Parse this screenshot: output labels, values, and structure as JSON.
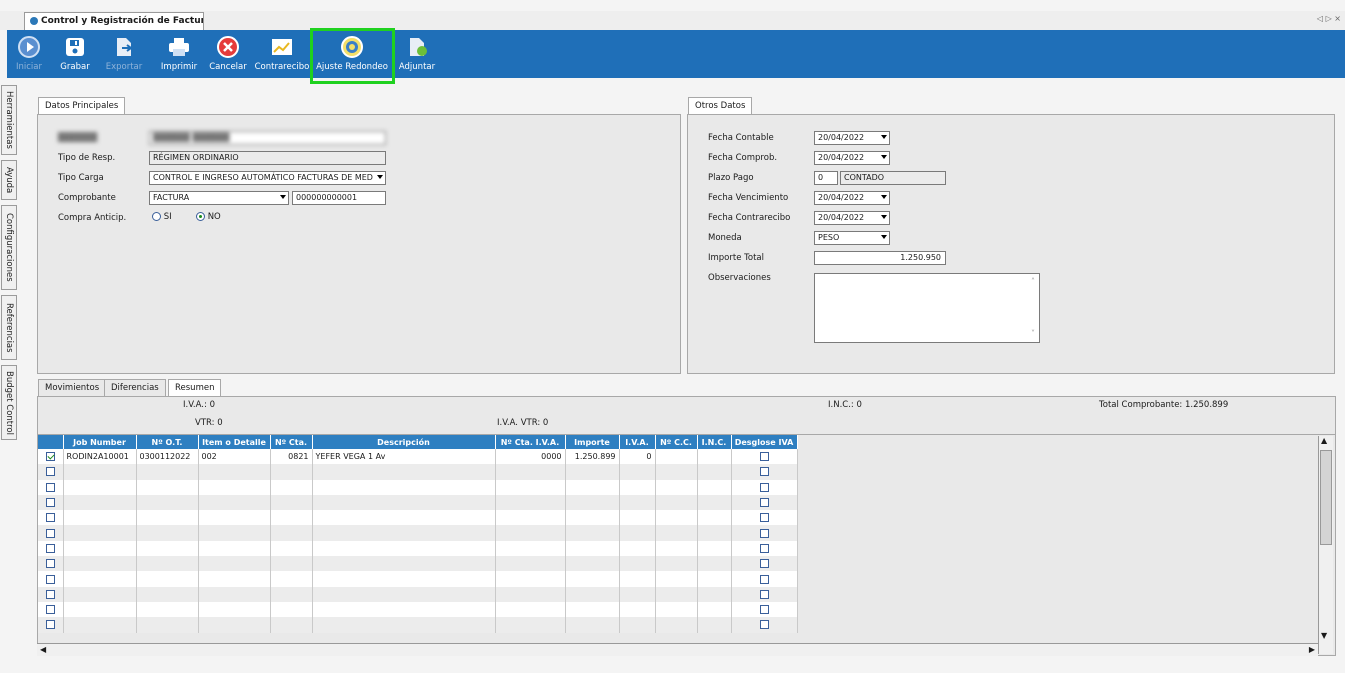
{
  "window": {
    "tab_title": "Control y Registración de Factura..."
  },
  "toolbar": {
    "iniciar": "Iniciar",
    "grabar": "Grabar",
    "exportar": "Exportar",
    "imprimir": "Imprimir",
    "cancelar": "Cancelar",
    "contrarecibo": "Contrarecibo",
    "ajuste": "Ajuste Redondeo",
    "adjuntar": "Adjuntar"
  },
  "side_tabs": [
    "Herramientas",
    "Ayuda",
    "Configuraciones",
    "Referencias",
    "Budget Control"
  ],
  "datos": {
    "tab": "Datos Principales",
    "tipo_resp_label": "Tipo de Resp.",
    "tipo_resp": "RÉGIMEN ORDINARIO",
    "tipo_carga_label": "Tipo Carga",
    "tipo_carga": "CONTROL E INGRESO AUTOMÁTICO FACTURAS DE MED",
    "comprobante_label": "Comprobante",
    "comprobante": "FACTURA",
    "comprobante_num": "000000000001",
    "compra_label": "Compra Anticip.",
    "si": "SI",
    "no": "NO"
  },
  "otros": {
    "tab": "Otros Datos",
    "fecha_contable_label": "Fecha Contable",
    "fecha_contable": "20/04/2022",
    "fecha_comprob_label": "Fecha Comprob.",
    "fecha_comprob": "20/04/2022",
    "plazo_label": "Plazo Pago",
    "plazo_num": "0",
    "plazo_text": "CONTADO",
    "venc_label": "Fecha Vencimiento",
    "venc": "20/04/2022",
    "contra_label": "Fecha Contrarecibo",
    "contra": "20/04/2022",
    "moneda_label": "Moneda",
    "moneda": "PESO",
    "importe_label": "Importe Total",
    "importe": "1.250.950",
    "obs_label": "Observaciones"
  },
  "lower": {
    "tabs": [
      "Movimientos",
      "Diferencias",
      "Resumen"
    ],
    "iva": "I.V.A.: 0",
    "vtr": "VTR: 0",
    "iva_vtr": "I.V.A. VTR: 0",
    "inc": "I.N.C.: 0",
    "total": "Total Comprobante: 1.250.899"
  },
  "grid": {
    "headers": [
      "Job Number",
      "Nº O.T.",
      "Item o Detalle",
      "Nº Cta.",
      "Descripción",
      "Nº Cta. I.V.A.",
      "Importe",
      "I.V.A.",
      "Nº C.C.",
      "I.N.C.",
      "Desglose IVA"
    ],
    "row1": [
      "RODIN2A10001",
      "0300112022",
      "002",
      "0821",
      "YEFER VEGA 1 Av",
      "0000",
      "1.250.899",
      "0",
      "",
      "",
      ""
    ]
  },
  "colors": {
    "toolbar": "#1f6fb8",
    "header": "#2e7fc1",
    "highlight": "#1fd11f"
  }
}
